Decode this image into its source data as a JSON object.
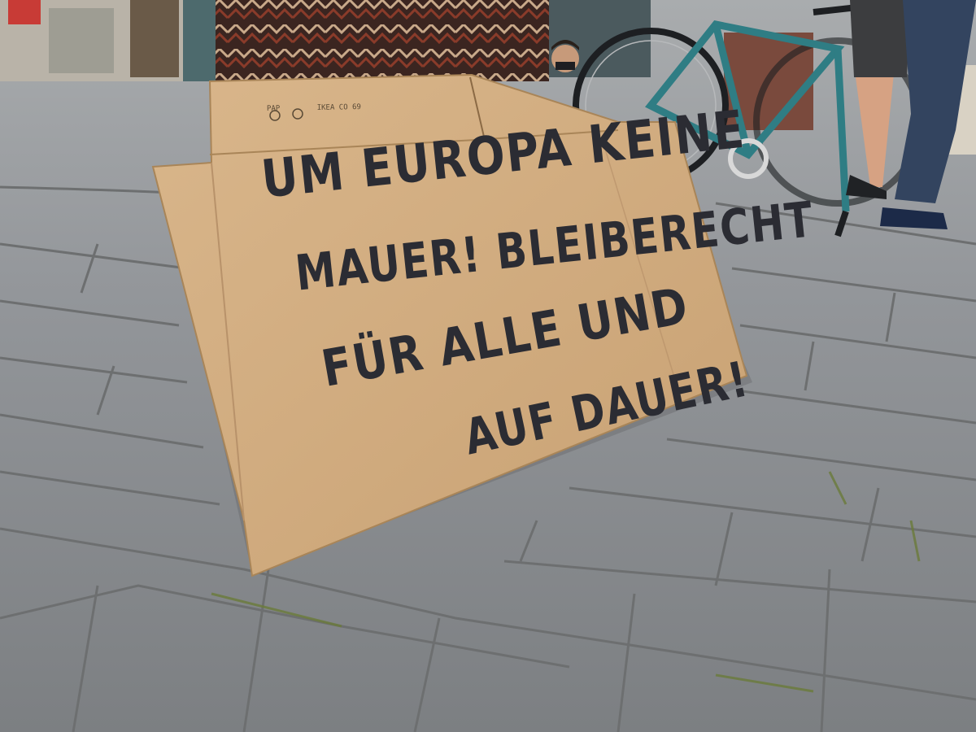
{
  "photo": {
    "subject": "cardboard protest sign on cobblestone pavement",
    "colors": {
      "cardboard": "#d2ad82",
      "cardboard_shadow": "#b8926a",
      "marker": "#2b2c33",
      "cobblestone": "#8c8f93",
      "grout": "#6d6f70",
      "moss": "#6a7a3a",
      "bicycle_frame": "#2f7d84",
      "fabric": "#6b3a2a"
    }
  },
  "sign": {
    "line1": "UM EUROPA KEINE",
    "line2": "MAUER! BLEIBERECHT",
    "line3": "FÜR ALLE UND",
    "line4": "AUF DAUER!"
  },
  "box_print": {
    "recycle": "PAP",
    "code": "IKEA CO 69"
  }
}
